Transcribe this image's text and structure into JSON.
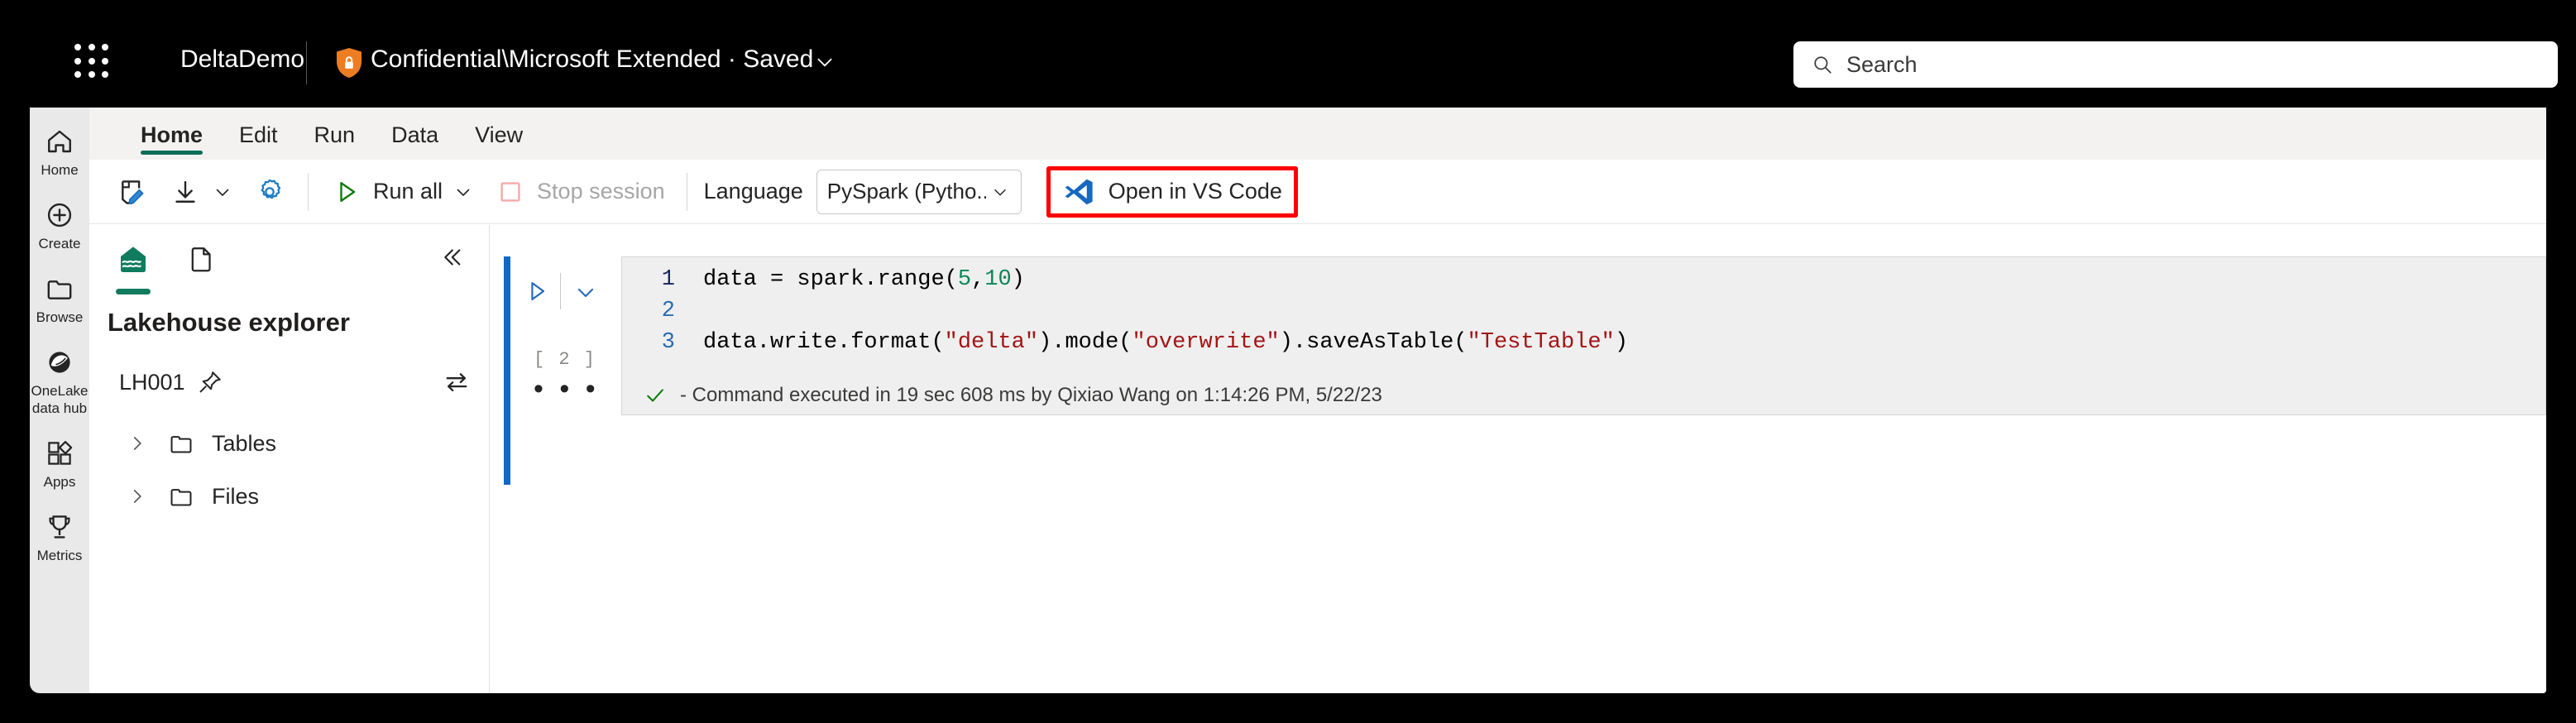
{
  "header": {
    "waffle_icon": "app-launcher-icon",
    "app_title": "DeltaDemo",
    "shield_icon": "sensitivity-shield-lock-icon",
    "sensitivity_label": "Confidential\\Microsoft Extended  ·  Saved",
    "chevron_icon": "chevron-down-icon",
    "search": {
      "icon": "search-icon",
      "placeholder": "Search",
      "value": ""
    }
  },
  "sidebar": {
    "items": [
      {
        "label": "Home",
        "icon": "home-icon"
      },
      {
        "label": "Create",
        "icon": "plus-circle-icon"
      },
      {
        "label": "Browse",
        "icon": "folder-icon"
      },
      {
        "label": "OneLake\ndata hub",
        "label_line1": "OneLake",
        "label_line2": "data hub",
        "icon": "onelake-icon"
      },
      {
        "label": "Apps",
        "icon": "apps-grid-icon"
      },
      {
        "label": "Metrics",
        "icon": "trophy-icon"
      }
    ]
  },
  "ribbon": {
    "tabs": [
      {
        "label": "Home",
        "active": true
      },
      {
        "label": "Edit",
        "active": false
      },
      {
        "label": "Run",
        "active": false
      },
      {
        "label": "Data",
        "active": false
      },
      {
        "label": "View",
        "active": false
      }
    ],
    "active_tab_color": "#0f6c58"
  },
  "toolbar": {
    "edit_icon": "save-edit-pencil-icon",
    "download_icon": "download-arrow-icon",
    "download_chevron_icon": "chevron-down-icon",
    "settings_icon": "gear-icon",
    "run_all_icon": "play-triangle-icon",
    "run_all_label": "Run all",
    "run_all_chevron_icon": "chevron-down-icon",
    "stop_session_icon": "stop-square-icon",
    "stop_session_label": "Stop session",
    "stop_session_disabled": true,
    "language_label": "Language",
    "language_value": "PySpark (Pytho...",
    "language_chevron_icon": "chevron-down-icon",
    "vscode_icon": "vscode-logo-icon",
    "vscode_label": "Open in VS Code",
    "vscode_highlight_color": "#ff0000"
  },
  "lakehouse": {
    "tab_lakehouse_icon": "lakehouse-icon",
    "tab_notebook_icon": "notebook-page-icon",
    "collapse_icon": "double-chevron-left-icon",
    "title": "Lakehouse explorer",
    "workspace_name": "LH001",
    "pin_icon": "pin-icon",
    "swap_icon": "swap-arrows-icon",
    "tree": [
      {
        "label": "Tables",
        "chevron_icon": "chevron-right-icon",
        "folder_icon": "folder-icon"
      },
      {
        "label": "Files",
        "chevron_icon": "chevron-right-icon",
        "folder_icon": "folder-icon"
      }
    ]
  },
  "notebook": {
    "cell": {
      "run_icon": "play-triangle-icon",
      "expand_icon": "chevron-down-icon",
      "execution_count": "[ 2 ]",
      "more_icon": "ellipsis-icon",
      "more_label": "• • •",
      "lines": [
        {
          "num": "1",
          "prefix": "data = spark.range(",
          "num1": "5",
          "comma": ",",
          "num2": "10",
          "suffix": ")"
        },
        {
          "num": "2",
          "text": ""
        },
        {
          "num": "3",
          "p1": "data.write.format(",
          "s1": "\"delta\"",
          "p2": ").mode(",
          "s2": "\"overwrite\"",
          "p3": ").saveAsTable(",
          "s3": "\"TestTable\"",
          "p4": ")"
        }
      ],
      "status_icon": "green-check-icon",
      "status_text": "- Command executed in 19 sec 608 ms by Qixiao Wang on 1:14:26 PM, 5/22/23"
    }
  }
}
